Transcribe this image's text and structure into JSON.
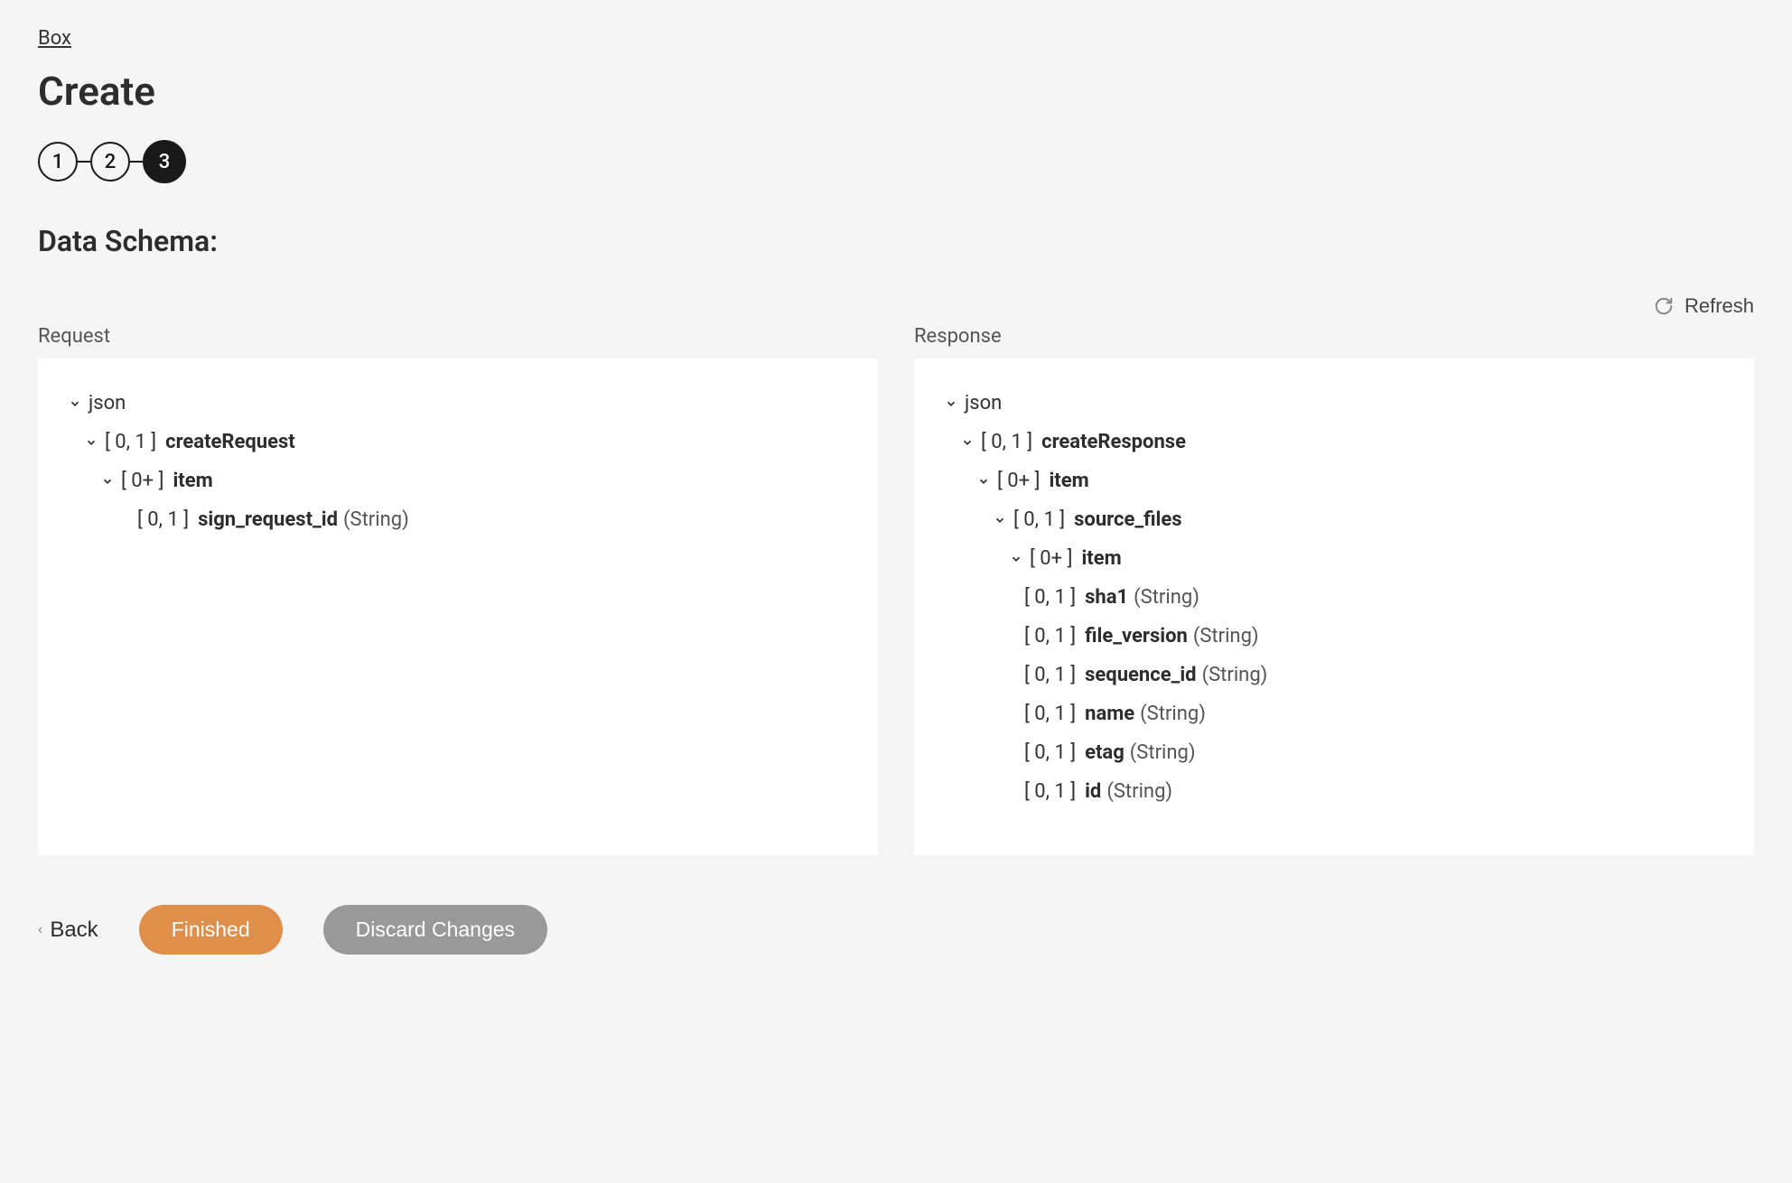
{
  "breadcrumb": {
    "label": "Box"
  },
  "page_title": "Create",
  "stepper": {
    "steps": [
      "1",
      "2",
      "3"
    ],
    "active_index": 2
  },
  "section_title": "Data Schema:",
  "refresh_label": "Refresh",
  "columns": {
    "request_label": "Request",
    "response_label": "Response"
  },
  "request_tree": {
    "root": "json",
    "n1": {
      "card": "[ 0, 1 ]",
      "name": "createRequest"
    },
    "n2": {
      "card": "[ 0+ ]",
      "name": "item"
    },
    "n3": {
      "card": "[ 0, 1 ]",
      "name": "sign_request_id",
      "type": "(String)"
    }
  },
  "response_tree": {
    "root": "json",
    "n1": {
      "card": "[ 0, 1 ]",
      "name": "createResponse"
    },
    "n2": {
      "card": "[ 0+ ]",
      "name": "item"
    },
    "n3": {
      "card": "[ 0, 1 ]",
      "name": "source_files"
    },
    "n4": {
      "card": "[ 0+ ]",
      "name": "item"
    },
    "f1": {
      "card": "[ 0, 1 ]",
      "name": "sha1",
      "type": "(String)"
    },
    "f2": {
      "card": "[ 0, 1 ]",
      "name": "file_version",
      "type": "(String)"
    },
    "f3": {
      "card": "[ 0, 1 ]",
      "name": "sequence_id",
      "type": "(String)"
    },
    "f4": {
      "card": "[ 0, 1 ]",
      "name": "name",
      "type": "(String)"
    },
    "f5": {
      "card": "[ 0, 1 ]",
      "name": "etag",
      "type": "(String)"
    },
    "f6": {
      "card": "[ 0, 1 ]",
      "name": "id",
      "type": "(String)"
    }
  },
  "footer": {
    "back": "Back",
    "finished": "Finished",
    "discard": "Discard Changes"
  }
}
